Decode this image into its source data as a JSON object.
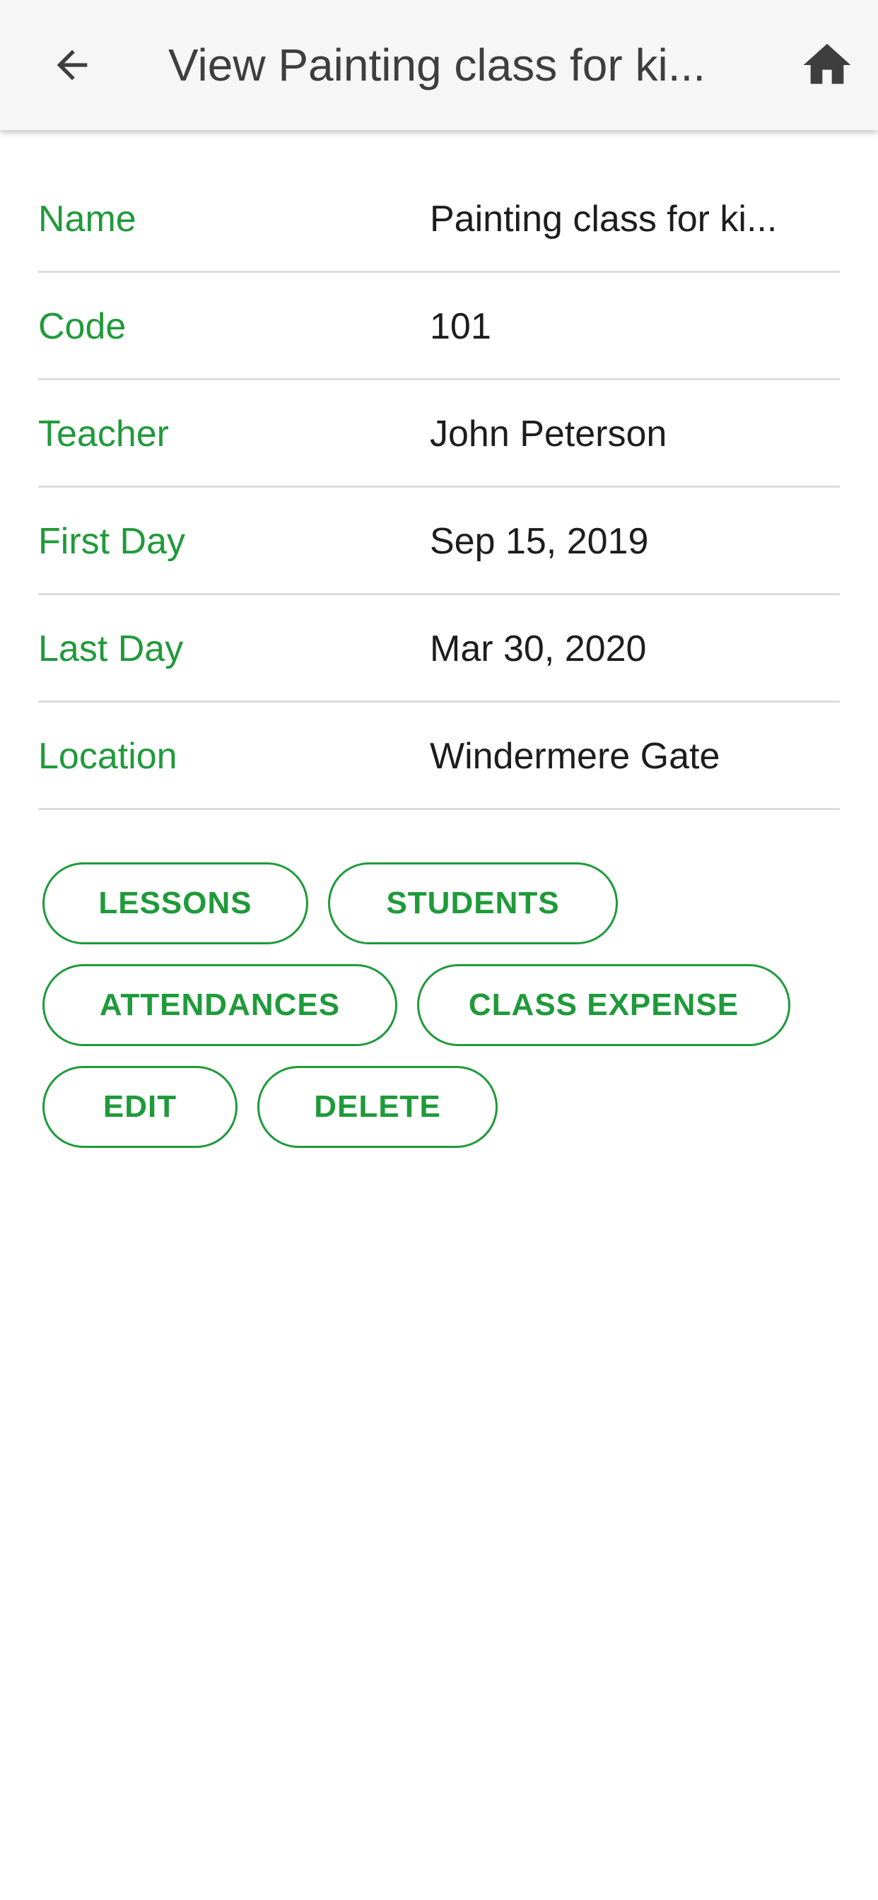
{
  "appbar": {
    "title": "View Painting class for ki...",
    "back_icon": "arrow-left-icon",
    "home_icon": "home-icon"
  },
  "details": [
    {
      "label": "Name",
      "value": "Painting class for ki..."
    },
    {
      "label": "Code",
      "value": "101"
    },
    {
      "label": "Teacher",
      "value": "John Peterson"
    },
    {
      "label": "First Day",
      "value": "Sep 15, 2019"
    },
    {
      "label": "Last Day",
      "value": "Mar 30, 2020"
    },
    {
      "label": "Location",
      "value": "Windermere Gate"
    }
  ],
  "actions": {
    "lessons": "LESSONS",
    "students": "STUDENTS",
    "attendances": "ATTENDANCES",
    "class_expense": "CLASS EXPENSE",
    "edit": "EDIT",
    "delete": "DELETE"
  },
  "colors": {
    "accent": "#1f9a3a",
    "appbar_bg": "#f6f6f6",
    "title_text": "#3e3e3e",
    "divider": "#dcdcdc"
  }
}
